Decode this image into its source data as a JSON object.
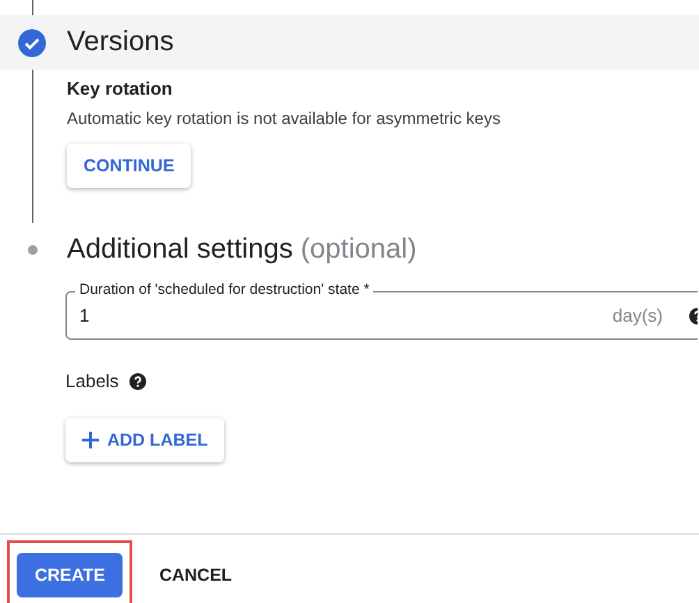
{
  "steps": [
    {
      "title": "Versions",
      "completed": true,
      "sections": [
        {
          "heading": "Key rotation",
          "text": "Automatic key rotation is not available for asymmetric keys"
        }
      ],
      "button": "CONTINUE"
    },
    {
      "title": "Additional settings",
      "optional": "(optional)",
      "completed": false,
      "field": {
        "label": "Duration of 'scheduled for destruction' state *",
        "value": "1",
        "suffix": "day(s)"
      },
      "labels_heading": "Labels",
      "add_button": "ADD LABEL"
    }
  ],
  "footer": {
    "buttons": [
      {
        "label": "CREATE",
        "kind": "primary",
        "highlighted": true
      },
      {
        "label": "CANCEL",
        "kind": "text",
        "highlighted": false
      }
    ]
  }
}
